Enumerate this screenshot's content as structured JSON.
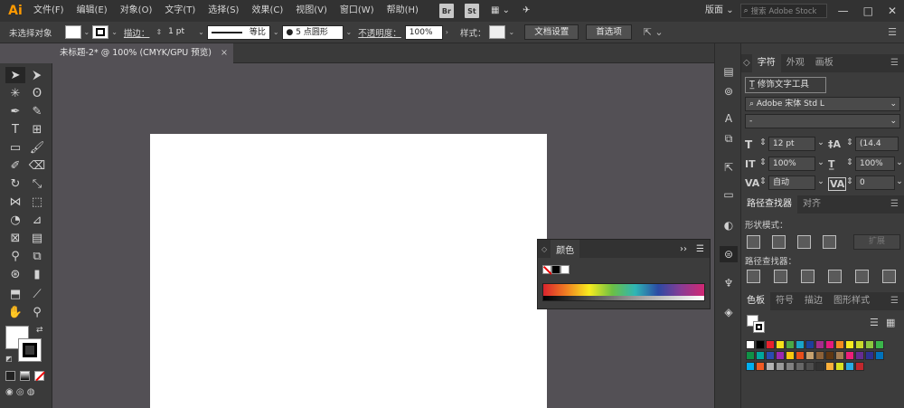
{
  "menubar": {
    "logo": "Ai",
    "items": [
      "文件(F)",
      "编辑(E)",
      "对象(O)",
      "文字(T)",
      "选择(S)",
      "效果(C)",
      "视图(V)",
      "窗口(W)",
      "帮助(H)"
    ],
    "bridge_badge": "Br",
    "stock_badge": "St",
    "workspace": "版面",
    "search_placeholder": "搜索 Adobe Stock",
    "minimize": "—",
    "maximize": "□",
    "close": "✕"
  },
  "controlbar": {
    "selection_label": "未选择对象",
    "stroke_label": "描边：",
    "stroke_weight": "1 pt",
    "stroke_profile": "等比",
    "brush_label": "5 点圆形",
    "opacity_label": "不透明度：",
    "opacity_value": "100%",
    "style_label": "样式：",
    "doc_setup": "文档设置",
    "preferences": "首选项"
  },
  "document": {
    "tab_title": "未标题-2* @ 100% (CMYK/GPU 预览)",
    "tab_close": "×"
  },
  "color_panel": {
    "title": "颜色",
    "expand": "››",
    "collapse": "◇"
  },
  "character_panel": {
    "tabs": [
      "字符",
      "外观",
      "画板"
    ],
    "touch_type_button": "修饰文字工具",
    "font_family": "Adobe 宋体 Std L",
    "font_style": "-",
    "font_size": "12 pt",
    "leading": "(14.4",
    "horizontal_scale": "100%",
    "vertical_scale": "100%",
    "kerning": "自动",
    "tracking": "0"
  },
  "pathfinder_panel": {
    "tabs": [
      "路径查找器",
      "对齐"
    ],
    "shape_modes_label": "形状模式：",
    "pathfinders_label": "路径查找器：",
    "expand_button": "扩展"
  },
  "swatches_panel": {
    "tabs": [
      "色板",
      "符号",
      "描边",
      "图形样式"
    ],
    "colors": [
      "#ffffff",
      "#000000",
      "#e8222d",
      "#f5e11a",
      "#4aa746",
      "#1aa3c8",
      "#1d3f9b",
      "#a62c8b",
      "#e6197e",
      "#f38b1f",
      "#f7ea1f",
      "#c8d92b",
      "#8cc63f",
      "#3ab54a",
      "#109146",
      "#00a99d",
      "#2a4cb0",
      "#9c27b0",
      "#f9c80e",
      "#e94e1b",
      "#c6a16f",
      "#8c6239",
      "#603813",
      "#a67c52",
      "#ed1e79",
      "#662d91",
      "#2e3192",
      "#0072bc",
      "#00aeef",
      "#f15a24",
      "#b3b3b3",
      "#999999",
      "#808080",
      "#666666",
      "#4d4d4d",
      "#333333",
      "#fbb03b",
      "#d9e021",
      "#29abe2",
      "#c1272d"
    ]
  }
}
